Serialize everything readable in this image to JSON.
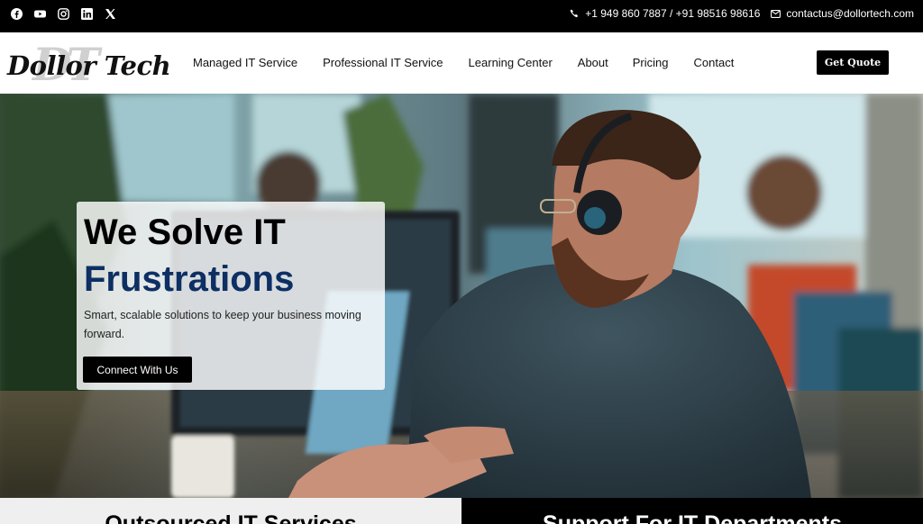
{
  "topbar": {
    "social_icons": [
      "facebook-icon",
      "youtube-icon",
      "instagram-icon",
      "linkedin-icon",
      "x-icon"
    ],
    "phone": "+1 949 860 7887 / +91 98516 98616",
    "email": "contactus@dollortech.com"
  },
  "header": {
    "logo_monogram": "DT",
    "logo_text": "Dollor Tech",
    "nav": [
      "Managed IT Service",
      "Professional IT Service",
      "Learning Center",
      "About",
      "Pricing",
      "Contact"
    ],
    "quote_button": "Get Quote"
  },
  "hero": {
    "title_line1": "We Solve IT",
    "title_line2": "Frustrations",
    "subtitle": "Smart, scalable solutions to keep your business moving forward.",
    "cta": "Connect With Us"
  },
  "sections": {
    "left_title": "Outsourced IT Services",
    "right_title": "Support For IT Departments"
  },
  "colors": {
    "accent": "#0d2f63",
    "topbar": "#000000",
    "button": "#000000"
  }
}
